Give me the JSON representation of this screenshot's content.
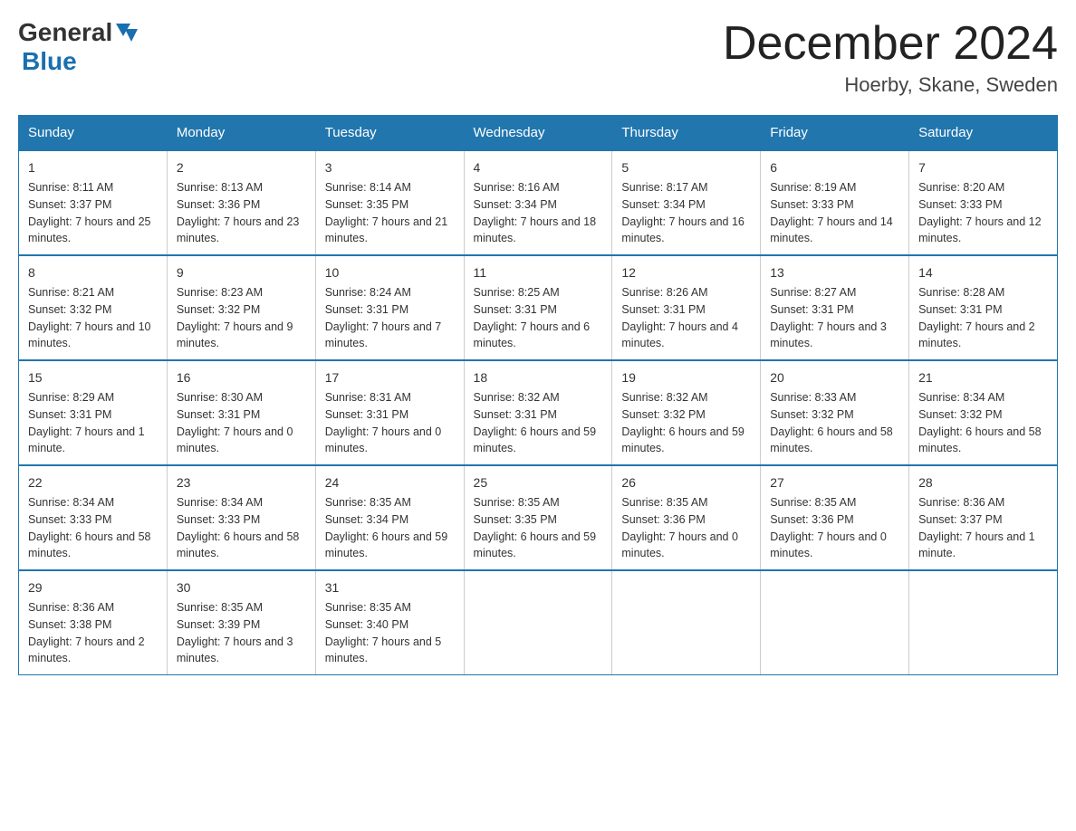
{
  "header": {
    "logo_general": "General",
    "logo_blue": "Blue",
    "month_year": "December 2024",
    "location": "Hoerby, Skane, Sweden"
  },
  "days_of_week": [
    "Sunday",
    "Monday",
    "Tuesday",
    "Wednesday",
    "Thursday",
    "Friday",
    "Saturday"
  ],
  "weeks": [
    [
      {
        "day": "1",
        "sunrise": "Sunrise: 8:11 AM",
        "sunset": "Sunset: 3:37 PM",
        "daylight": "Daylight: 7 hours and 25 minutes."
      },
      {
        "day": "2",
        "sunrise": "Sunrise: 8:13 AM",
        "sunset": "Sunset: 3:36 PM",
        "daylight": "Daylight: 7 hours and 23 minutes."
      },
      {
        "day": "3",
        "sunrise": "Sunrise: 8:14 AM",
        "sunset": "Sunset: 3:35 PM",
        "daylight": "Daylight: 7 hours and 21 minutes."
      },
      {
        "day": "4",
        "sunrise": "Sunrise: 8:16 AM",
        "sunset": "Sunset: 3:34 PM",
        "daylight": "Daylight: 7 hours and 18 minutes."
      },
      {
        "day": "5",
        "sunrise": "Sunrise: 8:17 AM",
        "sunset": "Sunset: 3:34 PM",
        "daylight": "Daylight: 7 hours and 16 minutes."
      },
      {
        "day": "6",
        "sunrise": "Sunrise: 8:19 AM",
        "sunset": "Sunset: 3:33 PM",
        "daylight": "Daylight: 7 hours and 14 minutes."
      },
      {
        "day": "7",
        "sunrise": "Sunrise: 8:20 AM",
        "sunset": "Sunset: 3:33 PM",
        "daylight": "Daylight: 7 hours and 12 minutes."
      }
    ],
    [
      {
        "day": "8",
        "sunrise": "Sunrise: 8:21 AM",
        "sunset": "Sunset: 3:32 PM",
        "daylight": "Daylight: 7 hours and 10 minutes."
      },
      {
        "day": "9",
        "sunrise": "Sunrise: 8:23 AM",
        "sunset": "Sunset: 3:32 PM",
        "daylight": "Daylight: 7 hours and 9 minutes."
      },
      {
        "day": "10",
        "sunrise": "Sunrise: 8:24 AM",
        "sunset": "Sunset: 3:31 PM",
        "daylight": "Daylight: 7 hours and 7 minutes."
      },
      {
        "day": "11",
        "sunrise": "Sunrise: 8:25 AM",
        "sunset": "Sunset: 3:31 PM",
        "daylight": "Daylight: 7 hours and 6 minutes."
      },
      {
        "day": "12",
        "sunrise": "Sunrise: 8:26 AM",
        "sunset": "Sunset: 3:31 PM",
        "daylight": "Daylight: 7 hours and 4 minutes."
      },
      {
        "day": "13",
        "sunrise": "Sunrise: 8:27 AM",
        "sunset": "Sunset: 3:31 PM",
        "daylight": "Daylight: 7 hours and 3 minutes."
      },
      {
        "day": "14",
        "sunrise": "Sunrise: 8:28 AM",
        "sunset": "Sunset: 3:31 PM",
        "daylight": "Daylight: 7 hours and 2 minutes."
      }
    ],
    [
      {
        "day": "15",
        "sunrise": "Sunrise: 8:29 AM",
        "sunset": "Sunset: 3:31 PM",
        "daylight": "Daylight: 7 hours and 1 minute."
      },
      {
        "day": "16",
        "sunrise": "Sunrise: 8:30 AM",
        "sunset": "Sunset: 3:31 PM",
        "daylight": "Daylight: 7 hours and 0 minutes."
      },
      {
        "day": "17",
        "sunrise": "Sunrise: 8:31 AM",
        "sunset": "Sunset: 3:31 PM",
        "daylight": "Daylight: 7 hours and 0 minutes."
      },
      {
        "day": "18",
        "sunrise": "Sunrise: 8:32 AM",
        "sunset": "Sunset: 3:31 PM",
        "daylight": "Daylight: 6 hours and 59 minutes."
      },
      {
        "day": "19",
        "sunrise": "Sunrise: 8:32 AM",
        "sunset": "Sunset: 3:32 PM",
        "daylight": "Daylight: 6 hours and 59 minutes."
      },
      {
        "day": "20",
        "sunrise": "Sunrise: 8:33 AM",
        "sunset": "Sunset: 3:32 PM",
        "daylight": "Daylight: 6 hours and 58 minutes."
      },
      {
        "day": "21",
        "sunrise": "Sunrise: 8:34 AM",
        "sunset": "Sunset: 3:32 PM",
        "daylight": "Daylight: 6 hours and 58 minutes."
      }
    ],
    [
      {
        "day": "22",
        "sunrise": "Sunrise: 8:34 AM",
        "sunset": "Sunset: 3:33 PM",
        "daylight": "Daylight: 6 hours and 58 minutes."
      },
      {
        "day": "23",
        "sunrise": "Sunrise: 8:34 AM",
        "sunset": "Sunset: 3:33 PM",
        "daylight": "Daylight: 6 hours and 58 minutes."
      },
      {
        "day": "24",
        "sunrise": "Sunrise: 8:35 AM",
        "sunset": "Sunset: 3:34 PM",
        "daylight": "Daylight: 6 hours and 59 minutes."
      },
      {
        "day": "25",
        "sunrise": "Sunrise: 8:35 AM",
        "sunset": "Sunset: 3:35 PM",
        "daylight": "Daylight: 6 hours and 59 minutes."
      },
      {
        "day": "26",
        "sunrise": "Sunrise: 8:35 AM",
        "sunset": "Sunset: 3:36 PM",
        "daylight": "Daylight: 7 hours and 0 minutes."
      },
      {
        "day": "27",
        "sunrise": "Sunrise: 8:35 AM",
        "sunset": "Sunset: 3:36 PM",
        "daylight": "Daylight: 7 hours and 0 minutes."
      },
      {
        "day": "28",
        "sunrise": "Sunrise: 8:36 AM",
        "sunset": "Sunset: 3:37 PM",
        "daylight": "Daylight: 7 hours and 1 minute."
      }
    ],
    [
      {
        "day": "29",
        "sunrise": "Sunrise: 8:36 AM",
        "sunset": "Sunset: 3:38 PM",
        "daylight": "Daylight: 7 hours and 2 minutes."
      },
      {
        "day": "30",
        "sunrise": "Sunrise: 8:35 AM",
        "sunset": "Sunset: 3:39 PM",
        "daylight": "Daylight: 7 hours and 3 minutes."
      },
      {
        "day": "31",
        "sunrise": "Sunrise: 8:35 AM",
        "sunset": "Sunset: 3:40 PM",
        "daylight": "Daylight: 7 hours and 5 minutes."
      },
      {
        "day": "",
        "sunrise": "",
        "sunset": "",
        "daylight": ""
      },
      {
        "day": "",
        "sunrise": "",
        "sunset": "",
        "daylight": ""
      },
      {
        "day": "",
        "sunrise": "",
        "sunset": "",
        "daylight": ""
      },
      {
        "day": "",
        "sunrise": "",
        "sunset": "",
        "daylight": ""
      }
    ]
  ]
}
